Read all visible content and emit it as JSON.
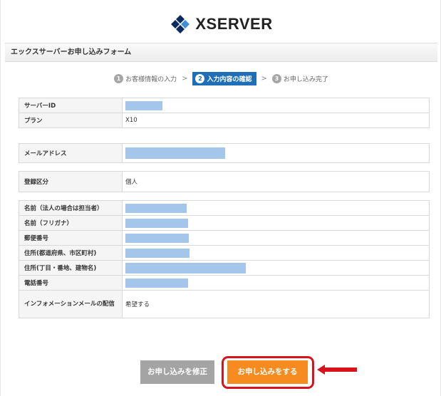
{
  "logo": {
    "text": "XSERVER",
    "icon": "diamond-cluster-icon",
    "colors": [
      "#0b2a63",
      "#3f8fd4",
      "#222222"
    ]
  },
  "form_title": "エックスサーバーお申し込みフォーム",
  "steps": [
    {
      "num": "1",
      "label": "お客様情報の入力"
    },
    {
      "num": "2",
      "label": "入力内容の確認"
    },
    {
      "num": "3",
      "label": "お申し込み完了"
    }
  ],
  "step_separator": ">",
  "groups": [
    {
      "rows": [
        {
          "label": "サーバーID",
          "value": "",
          "redacted": true
        },
        {
          "label": "プラン",
          "value": "X10",
          "redacted": false
        }
      ]
    },
    {
      "rows": [
        {
          "label": "メールアドレス",
          "value": "",
          "redacted": true
        }
      ]
    },
    {
      "rows": [
        {
          "label": "登録区分",
          "value": "個人",
          "redacted": false
        }
      ]
    },
    {
      "rows": [
        {
          "label": "名前（法人の場合は担当者）",
          "value": "",
          "redacted": true
        },
        {
          "label": "名前（フリガナ）",
          "value": "",
          "redacted": true
        },
        {
          "label": "郵便番号",
          "value": "",
          "redacted": true
        },
        {
          "label": "住所(都道府県、市区町村)",
          "value": "",
          "redacted": true
        },
        {
          "label": "住所(丁目・番地、建物名)",
          "value": "",
          "redacted": true
        },
        {
          "label": "電話番号",
          "value": "",
          "redacted": true
        },
        {
          "label": "インフォメーションメールの配信",
          "value": "希望する",
          "redacted": false
        }
      ]
    }
  ],
  "buttons": {
    "modify": "お申し込みを修正",
    "submit": "お申し込みをする"
  },
  "colors": {
    "active_step": "#1f6fb8",
    "submit": "#f68b1f",
    "modify": "#a4a4a4",
    "annotation": "#d7141e",
    "redaction": "#a3c6ea"
  }
}
